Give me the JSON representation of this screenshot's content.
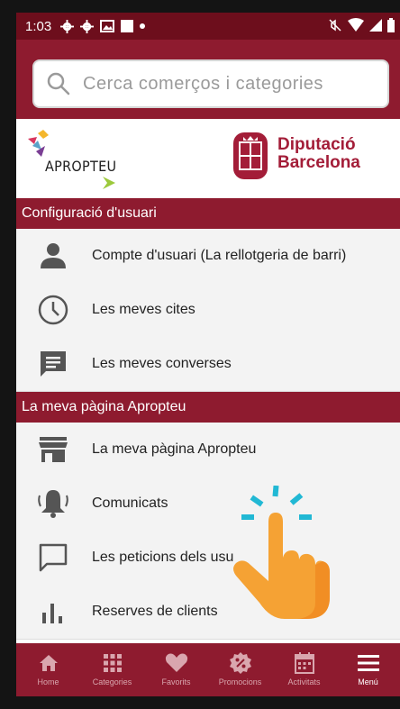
{
  "status_bar": {
    "time": "1:03",
    "left_icons": [
      "gear-icon",
      "gear-icon",
      "image-icon",
      "square-icon",
      "dot-icon"
    ],
    "right_icons": [
      "mute-icon",
      "wifi-icon",
      "signal-icon",
      "battery-icon"
    ]
  },
  "search": {
    "placeholder": "Cerca comerços i categories"
  },
  "logos": {
    "apropteu": "APROPTEU",
    "diputacio_line1": "Diputació",
    "diputacio_line2": "Barcelona"
  },
  "sections": [
    {
      "title": "Configuració d'usuari",
      "items": [
        {
          "label": "Compte d'usuari (La rellotgeria de barri)",
          "icon": "user-icon"
        },
        {
          "label": "Les meves cites",
          "icon": "clock-icon"
        },
        {
          "label": "Les meves converses",
          "icon": "chat-icon"
        }
      ]
    },
    {
      "title": "La meva pàgina Apropteu",
      "items": [
        {
          "label": "La meva pàgina Apropteu",
          "icon": "store-icon"
        },
        {
          "label": "Comunicats",
          "icon": "bell-icon"
        },
        {
          "label": "Les peticions dels usu",
          "icon": "message-icon"
        },
        {
          "label": "Reserves de clients",
          "icon": "bar-chart-icon"
        }
      ]
    }
  ],
  "bottom_nav": [
    {
      "label": "Home",
      "icon": "home-icon"
    },
    {
      "label": "Categories",
      "icon": "grid-icon"
    },
    {
      "label": "Favorits",
      "icon": "heart-icon"
    },
    {
      "label": "Promocions",
      "icon": "percent-badge-icon"
    },
    {
      "label": "Activitats",
      "icon": "calendar-icon"
    },
    {
      "label": "Menú",
      "icon": "menu-icon",
      "active": true
    }
  ],
  "colors": {
    "brand": "#8e1b2f",
    "status_bar": "#6d0e1c",
    "hand": "#f5a234"
  }
}
